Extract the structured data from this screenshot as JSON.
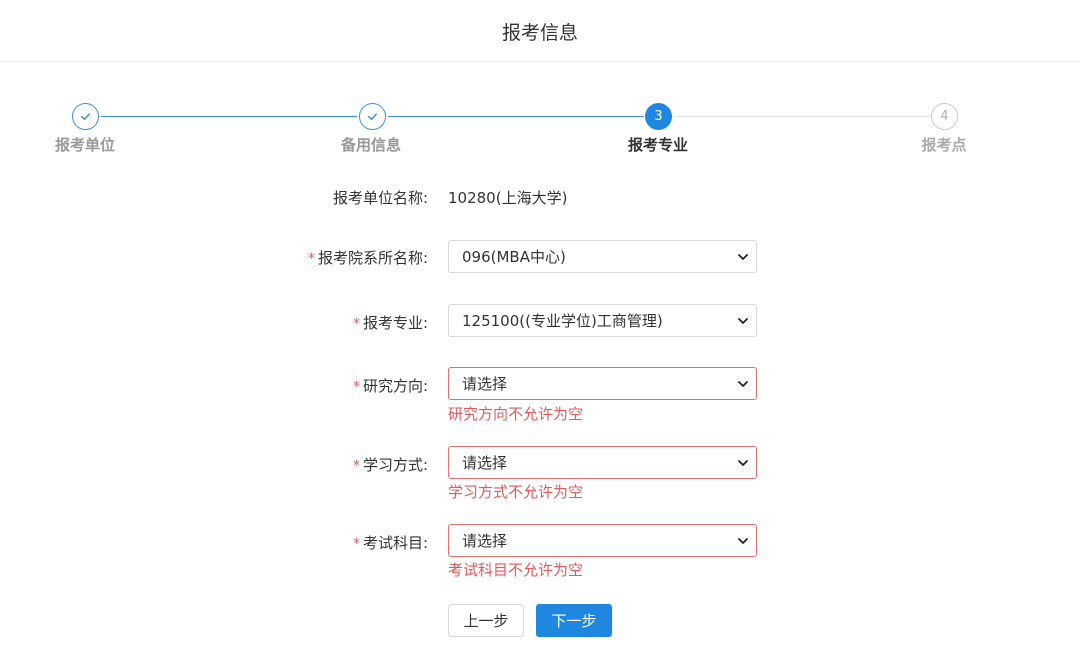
{
  "header": {
    "title": "报考信息"
  },
  "steps": [
    {
      "label": "报考单位",
      "state": "done"
    },
    {
      "label": "备用信息",
      "state": "done"
    },
    {
      "label": "报考专业",
      "number": "3",
      "state": "current"
    },
    {
      "label": "报考点",
      "number": "4",
      "state": "todo"
    }
  ],
  "form": {
    "unit_name": {
      "label": "报考单位名称:",
      "value": "10280(上海大学)"
    },
    "department": {
      "required_mark": "*",
      "label": "报考院系所名称:",
      "value": "096(MBA中心)"
    },
    "major": {
      "required_mark": "*",
      "label": "报考专业:",
      "value": "125100((专业学位)工商管理)"
    },
    "research_direction": {
      "required_mark": "*",
      "label": "研究方向:",
      "value": "请选择",
      "error": "研究方向不允许为空"
    },
    "study_mode": {
      "required_mark": "*",
      "label": "学习方式:",
      "value": "请选择",
      "error": "学习方式不允许为空"
    },
    "exam_subjects": {
      "required_mark": "*",
      "label": "考试科目:",
      "value": "请选择",
      "error": "考试科目不允许为空"
    }
  },
  "buttons": {
    "prev": "上一步",
    "next": "下一步"
  },
  "colors": {
    "primary": "#1f87e0",
    "error": "#e25a5a",
    "step_done": "#3a8fd9"
  }
}
